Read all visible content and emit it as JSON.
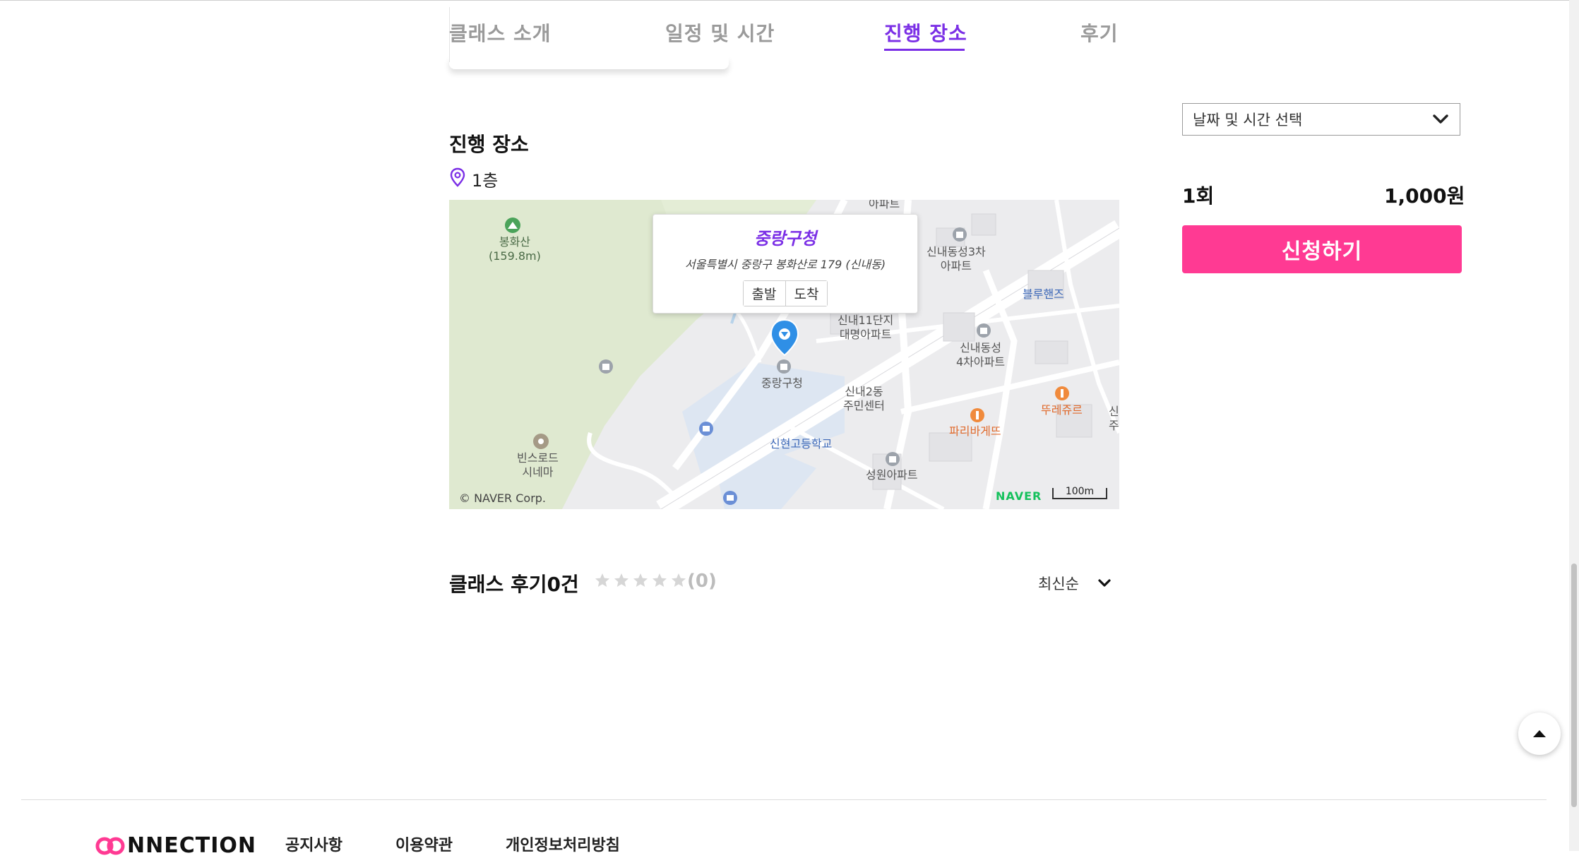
{
  "tabs": [
    {
      "label": "클래스 소개"
    },
    {
      "label": "일정 및 시간"
    },
    {
      "label": "진행 장소"
    },
    {
      "label": "후기"
    }
  ],
  "location": {
    "section_title": "진행 장소",
    "floor": "1층"
  },
  "map": {
    "popup_title": "중랑구청",
    "popup_address": "서울특별시 중랑구 봉화산로 179 (신내동)",
    "depart_label": "출발",
    "arrive_label": "도착",
    "labels": {
      "apt_top": "아파트",
      "bonghwasan": "봉화산",
      "bonghwasan_height": "(159.8m)",
      "sinnae3": "신내동성3차",
      "sinnae3_apt": "아파트",
      "bluehands": "블루핸즈",
      "sinnae11": "신내11단지",
      "daemyung": "대명아파트",
      "sinnae4": "신내동성",
      "sinnae4_apt": "4차아파트",
      "jungnang": "중랑구청",
      "sinnae2dong": "신내2동",
      "community": "주민센터",
      "touslesjours": "뚜레쥬르",
      "parisbaguette": "파리바게뜨",
      "edge_sin": "신",
      "edge_ju": "주",
      "sinhyeon": "신현고등학교",
      "binsroad": "빈스로드",
      "cinema": "시네마",
      "seongwon": "성원아파트"
    },
    "copyright": "© NAVER Corp.",
    "brand": "NAVER",
    "scale": "100m"
  },
  "reviews": {
    "title": "클래스 후기0건",
    "rating": "(0)",
    "sort": "최신순"
  },
  "booking": {
    "date_placeholder": "날짜 및 시간 선택",
    "count": "1회",
    "price": "1,000원",
    "apply_label": "신청하기"
  },
  "footer": {
    "logo_text": "NNECTION",
    "links": [
      "공지사항",
      "이용약관",
      "개인정보처리방침"
    ]
  },
  "colors": {
    "accent_purple": "#7b2fe6",
    "apply_pink": "#ff3a93"
  }
}
